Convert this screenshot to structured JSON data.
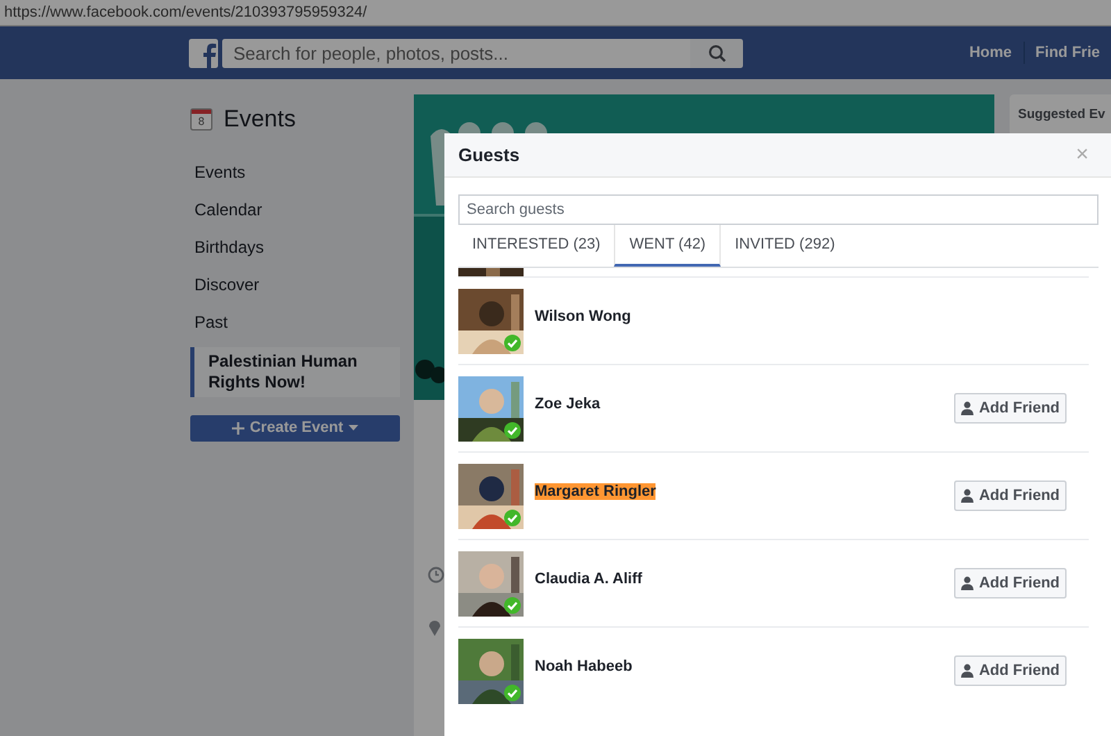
{
  "browser": {
    "url": "https://www.facebook.com/events/210393795959324/"
  },
  "header": {
    "search_placeholder": "Search for people, photos, posts...",
    "nav": [
      "Home",
      "Find Frie"
    ]
  },
  "sidebar": {
    "title": "Events",
    "calendar_day": "8",
    "items": [
      {
        "label": "Events",
        "selected": false
      },
      {
        "label": "Calendar",
        "selected": false
      },
      {
        "label": "Birthdays",
        "selected": false
      },
      {
        "label": "Discover",
        "selected": false
      },
      {
        "label": "Past",
        "selected": false
      },
      {
        "label": "Palestinian Human Rights Now!",
        "selected": true
      }
    ],
    "create_button": "Create Event"
  },
  "suggested": {
    "title": "Suggested Ev"
  },
  "modal": {
    "title": "Guests",
    "close": "×",
    "search_placeholder": "Search guests",
    "tabs": [
      {
        "label": "INTERESTED (23)",
        "selected": false
      },
      {
        "label": "WENT (42)",
        "selected": true
      },
      {
        "label": "INVITED (292)",
        "selected": false
      }
    ],
    "guests": [
      {
        "name": "Wilson Wong",
        "highlighted": false
      },
      {
        "name": "Zoe Jeka",
        "highlighted": false,
        "button": "Add Friend"
      },
      {
        "name": "Margaret Ringler",
        "highlighted": true,
        "button": "Add Friend"
      },
      {
        "name": "Claudia A. Aliff",
        "highlighted": false,
        "button": "Add Friend"
      },
      {
        "name": "Noah Habeeb",
        "highlighted": false,
        "button": "Add Friend"
      }
    ]
  }
}
